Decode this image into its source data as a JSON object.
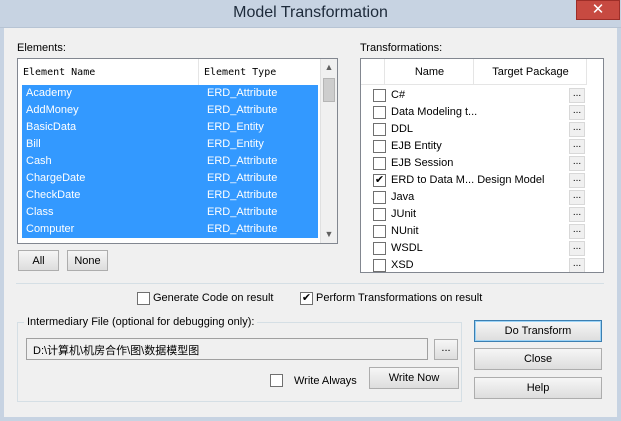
{
  "window": {
    "title": "Model Transformation",
    "close_glyph": "✕"
  },
  "elements": {
    "label": "Elements:",
    "columns": [
      "Element Name",
      "Element Type"
    ],
    "rows": [
      {
        "name": "Academy",
        "type": "ERD_Attribute"
      },
      {
        "name": "AddMoney",
        "type": "ERD_Attribute"
      },
      {
        "name": "BasicData",
        "type": "ERD_Entity"
      },
      {
        "name": "Bill",
        "type": "ERD_Entity"
      },
      {
        "name": "Cash",
        "type": "ERD_Attribute"
      },
      {
        "name": "ChargeDate",
        "type": "ERD_Attribute"
      },
      {
        "name": "CheckDate",
        "type": "ERD_Attribute"
      },
      {
        "name": "Class",
        "type": "ERD_Attribute"
      },
      {
        "name": "Computer",
        "type": "ERD_Attribute"
      }
    ],
    "all_button": "All",
    "none_button": "None"
  },
  "transformations": {
    "label": "Transformations:",
    "columns": [
      "Name",
      "Target Package"
    ],
    "dots_label": "...",
    "rows": [
      {
        "name": "C#",
        "checked": false
      },
      {
        "name": "Data Modeling t...",
        "checked": false
      },
      {
        "name": "DDL",
        "checked": false
      },
      {
        "name": "EJB Entity",
        "checked": false
      },
      {
        "name": "EJB Session",
        "checked": false
      },
      {
        "name": "ERD to Data M... Design Model",
        "checked": true
      },
      {
        "name": "Java",
        "checked": false
      },
      {
        "name": "JUnit",
        "checked": false
      },
      {
        "name": "NUnit",
        "checked": false
      },
      {
        "name": "WSDL",
        "checked": false
      },
      {
        "name": "XSD",
        "checked": false
      }
    ]
  },
  "options": {
    "generate_code": {
      "label": "Generate Code on result",
      "checked": false
    },
    "perform_transformations": {
      "label": "Perform Transformations on result",
      "checked": true
    }
  },
  "intermediary": {
    "label": "Intermediary File (optional for debugging only):",
    "path": "D:\\计算机\\机房合作\\图\\数据模型图",
    "browse_label": "...",
    "write_always_label": "Write Always",
    "write_always_checked": false,
    "write_now_label": "Write Now"
  },
  "buttons": {
    "do_transform": "Do Transform",
    "close": "Close",
    "help": "Help"
  },
  "colors": {
    "selection": "#3399ff",
    "titlebar": "#c7d3e2",
    "close_button": "#c74a41"
  }
}
